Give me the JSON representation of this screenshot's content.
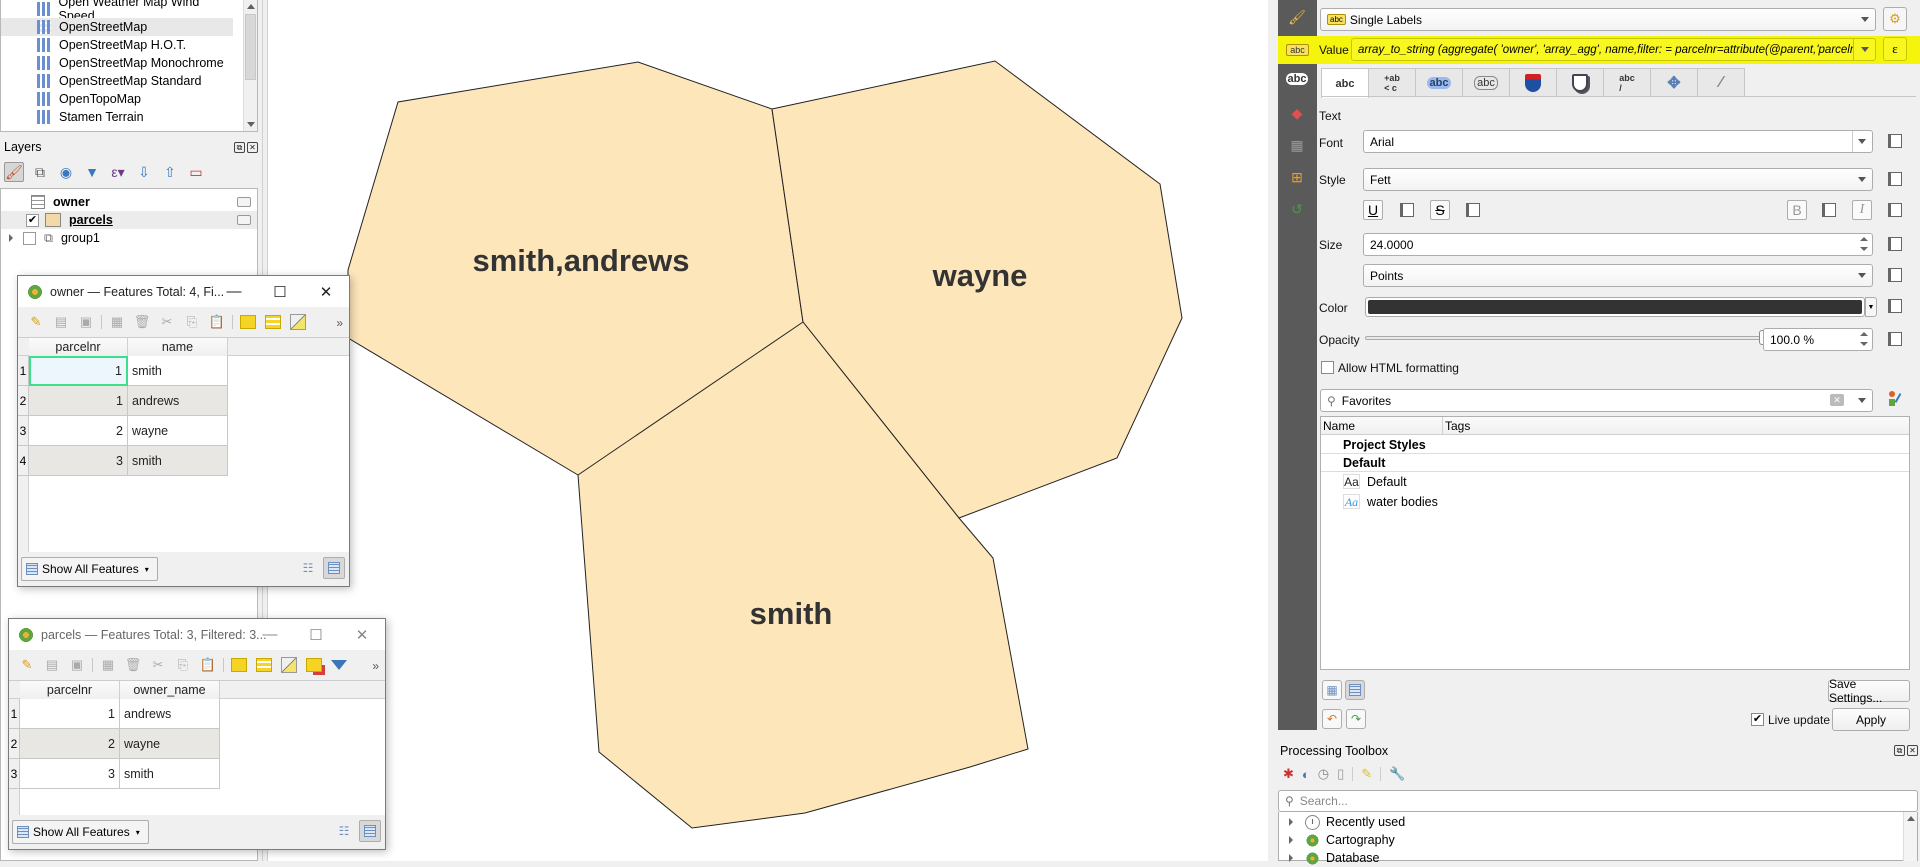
{
  "browser": {
    "items": [
      {
        "label": "Open Weather Map Wind Speed",
        "selected": false
      },
      {
        "label": "OpenStreetMap",
        "selected": true
      },
      {
        "label": "OpenStreetMap H.O.T.",
        "selected": false
      },
      {
        "label": "OpenStreetMap Monochrome",
        "selected": false
      },
      {
        "label": "OpenStreetMap Standard",
        "selected": false
      },
      {
        "label": "OpenTopoMap",
        "selected": false
      },
      {
        "label": "Stamen Terrain",
        "selected": false
      }
    ]
  },
  "layers": {
    "title": "Layers",
    "dock_float": "⧉",
    "dock_close": "✕",
    "items": [
      {
        "label": "owner",
        "type": "table",
        "checked": null,
        "bold": true
      },
      {
        "label": "parcels",
        "type": "polygon",
        "checked": true,
        "bold": true,
        "underline": true
      },
      {
        "label": "group1",
        "type": "group",
        "checked": false,
        "bold": false
      }
    ]
  },
  "map": {
    "background": "#ffffff",
    "fill_color": "#fee6bb",
    "parcels": [
      {
        "label": "smith,andrews"
      },
      {
        "label": "wayne"
      },
      {
        "label": "smith"
      }
    ]
  },
  "owner_window": {
    "title": "owner — Features Total: 4, Fi...",
    "minimize": "—",
    "maximize": "☐",
    "close": "✕",
    "more": "»",
    "columns": [
      "parcelnr",
      "name"
    ],
    "rows": [
      {
        "id": "1",
        "parcelnr": "1",
        "name": "smith"
      },
      {
        "id": "2",
        "parcelnr": "1",
        "name": "andrews"
      },
      {
        "id": "3",
        "parcelnr": "2",
        "name": "wayne"
      },
      {
        "id": "4",
        "parcelnr": "3",
        "name": "smith"
      }
    ],
    "filter_button": "Show All Features"
  },
  "parcels_window": {
    "title": "parcels — Features Total: 3, Filtered: 3...",
    "minimize": "—",
    "maximize": "☐",
    "close": "✕",
    "more": "»",
    "columns": [
      "parcelnr",
      "owner_name"
    ],
    "rows": [
      {
        "id": "1",
        "parcelnr": "1",
        "owner_name": "andrews"
      },
      {
        "id": "2",
        "parcelnr": "2",
        "owner_name": "wayne"
      },
      {
        "id": "3",
        "parcelnr": "3",
        "owner_name": "smith"
      }
    ],
    "filter_button": "Show All Features"
  },
  "labeling": {
    "mode": "Single Labels",
    "value_label": "Value",
    "value_expression": "array_to_string (aggregate( 'owner', 'array_agg', name,filter: = parcelnr=attribute(@parent,'parcelnr')))",
    "expression_button": "ε",
    "tabs": [
      "abc",
      "+ab <c",
      "abc",
      "abc",
      "shield",
      "shield",
      "abc /",
      "move",
      "brush"
    ],
    "section_title": "Text",
    "font_label": "Font",
    "font_value": "Arial",
    "style_label": "Style",
    "style_value": "Fett",
    "underline": "U",
    "strikeout": "S",
    "bold": "B",
    "italic": "I",
    "size_label": "Size",
    "size_value": "24.0000",
    "unit_value": "Points",
    "color_label": "Color",
    "color_value": "#333333",
    "opacity_label": "Opacity",
    "opacity_percent": 100,
    "opacity_text": "100.0 %",
    "html_label": "Allow HTML formatting",
    "html_checked": false,
    "search_value": "Favorites",
    "list_columns": [
      "Name",
      "Tags"
    ],
    "list_groups": [
      "Project Styles",
      "Default"
    ],
    "list_items": [
      {
        "icon": "Aa",
        "label": "Default"
      },
      {
        "icon": "Aa",
        "label": "water bodies"
      }
    ],
    "save_settings": "Save Settings...",
    "live_update_label": "Live update",
    "live_update_checked": true,
    "apply": "Apply"
  },
  "processing": {
    "title": "Processing Toolbox",
    "search_placeholder": "Search...",
    "items": [
      "Recently used",
      "Cartography",
      "Database"
    ]
  }
}
